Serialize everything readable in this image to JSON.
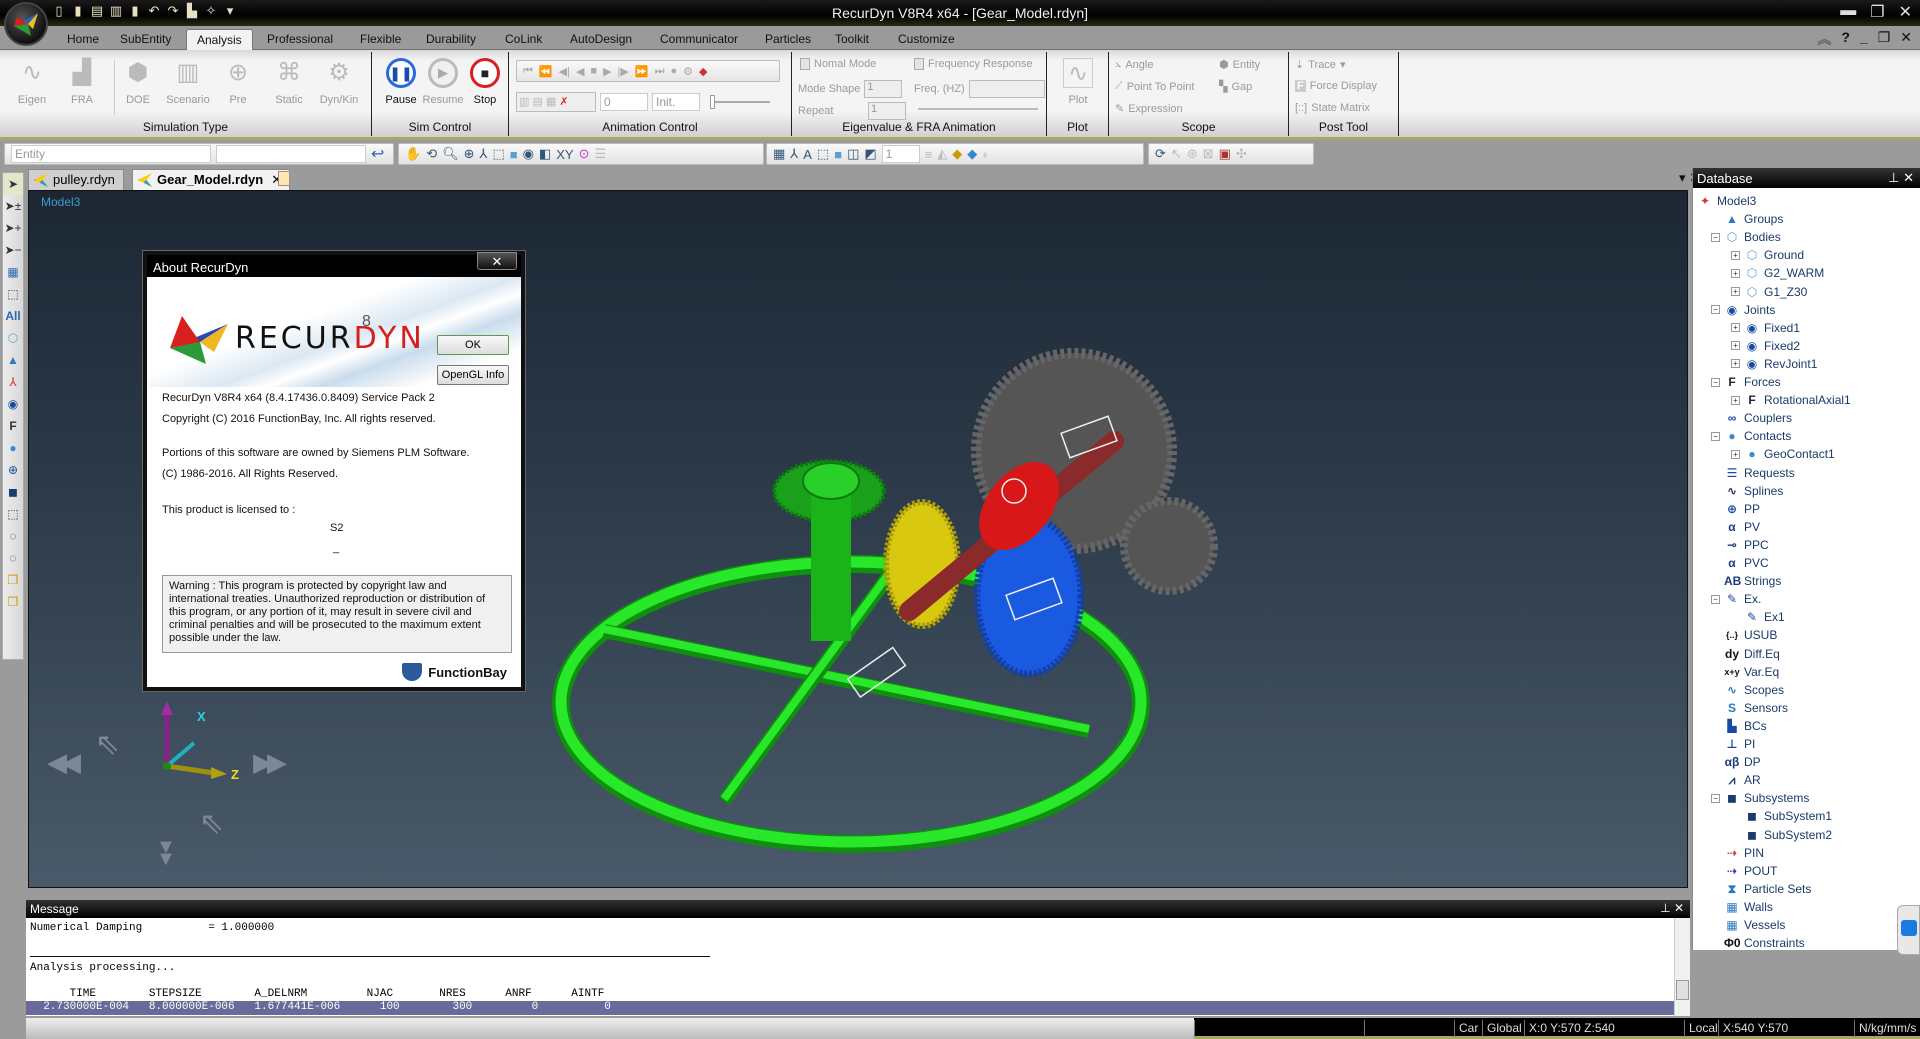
{
  "window": {
    "title": "RecurDyn V8R4 x64 - [Gear_Model.rdyn]"
  },
  "quick_access": [
    "new-icon",
    "open-icon",
    "save-icon",
    "save-as-icon",
    "import-icon",
    "undo-icon",
    "redo-icon",
    "export-icon",
    "settings-icon"
  ],
  "ribbon_tabs": [
    "Home",
    "SubEntity",
    "Analysis",
    "Professional",
    "Flexible",
    "Durability",
    "CoLink",
    "AutoDesign",
    "Communicator",
    "Particles",
    "Toolkit",
    "Customize"
  ],
  "active_tab": "Analysis",
  "ribbon": {
    "simulation_type": {
      "label": "Simulation Type",
      "buttons": [
        "Eigen",
        "FRA",
        "DOE",
        "Scenario",
        "Pre",
        "Static",
        "Dyn/Kin"
      ]
    },
    "sim_control": {
      "label": "Sim Control",
      "pause": "Pause",
      "resume": "Resume",
      "stop": "Stop"
    },
    "animation_control": {
      "label": "Animation Control",
      "frame_value": "0",
      "frame_mode": "Init."
    },
    "eigen_fra": {
      "label": "Eigenvalue & FRA Animation",
      "normal_mode": "Nomal Mode",
      "mode_shape": "Mode Shape",
      "mode_shape_value": "1",
      "repeat": "Repeat",
      "repeat_value": "1",
      "frequency_response": "Frequency Response",
      "freq": "Freq. (HZ)"
    },
    "plot": {
      "label": "Plot",
      "button": "Plot"
    },
    "scope": {
      "label": "Scope",
      "items": [
        "Angle",
        "Entity",
        "Point To Point",
        "Gap",
        "Expression"
      ]
    },
    "post_tool": {
      "label": "Post Tool",
      "items": [
        "Trace",
        "Force Display",
        "State Matrix"
      ]
    }
  },
  "toolbar": {
    "entity_combo": "Entity",
    "page_value": "1"
  },
  "doc_tabs": [
    {
      "label": "pulley.rdyn"
    },
    {
      "label": "Gear_Model.rdyn"
    }
  ],
  "viewport": {
    "model_label": "Model3",
    "axis_labels": {
      "x": "X",
      "z": "Z"
    }
  },
  "about_dialog": {
    "title": "About RecurDyn",
    "logo_prefix": "RECUR",
    "logo_suffix": "DYN",
    "logo_version": "8",
    "ok": "OK",
    "opengl": "OpenGL Info",
    "version_line": "RecurDyn V8R4 x64 (8.4.17436.0.8409) Service Pack 2",
    "copyright": "Copyright (C) 2016 FunctionBay, Inc. All rights reserved.",
    "portions": "Portions of this software are owned by Siemens PLM Software.",
    "portions_copyright": "(C) 1986-2016. All Rights Reserved.",
    "licensed_to_label": "This product is licensed to :",
    "licensee": "S2",
    "licensee_2": "_",
    "warning": "Warning : This program is protected by copyright law and international treaties. Unauthorized reproduction or distribution of this program, or any portion of it, may result in severe civil and criminal penalties and will be prosecuted to the maximum extent possible under the law.",
    "company": "FunctionBay"
  },
  "database": {
    "title": "Database",
    "items": [
      {
        "label": "Model3",
        "level": 0,
        "icon": "model-icon",
        "glyph": "✦",
        "color": "#d33"
      },
      {
        "label": "Groups",
        "level": 1,
        "icon": "groups-icon",
        "glyph": "▲",
        "color": "#2a7ac0"
      },
      {
        "label": "Bodies",
        "level": 1,
        "icon": "body-icon",
        "glyph": "⬡",
        "color": "#5aa0d0",
        "toggle": "−"
      },
      {
        "label": "Ground",
        "level": 2,
        "icon": "body-icon",
        "glyph": "⬡",
        "color": "#5aa0d0",
        "toggle": "+"
      },
      {
        "label": "G2_WARM",
        "level": 2,
        "icon": "body-icon",
        "glyph": "⬡",
        "color": "#5aa0d0",
        "toggle": "+"
      },
      {
        "label": "G1_Z30",
        "level": 2,
        "icon": "body-icon",
        "glyph": "⬡",
        "color": "#5aa0d0",
        "toggle": "+"
      },
      {
        "label": "Joints",
        "level": 1,
        "icon": "joint-icon",
        "glyph": "◉",
        "color": "#1a4aa0",
        "toggle": "−"
      },
      {
        "label": "Fixed1",
        "level": 2,
        "icon": "joint-icon",
        "glyph": "◉",
        "color": "#1a4aa0",
        "toggle": "+"
      },
      {
        "label": "Fixed2",
        "level": 2,
        "icon": "joint-icon",
        "glyph": "◉",
        "color": "#1a4aa0",
        "toggle": "+"
      },
      {
        "label": "RevJoint1",
        "level": 2,
        "icon": "joint-icon",
        "glyph": "◉",
        "color": "#1a4aa0",
        "toggle": "+"
      },
      {
        "label": "Forces",
        "level": 1,
        "icon": "force-icon",
        "glyph": "F",
        "color": "#223",
        "toggle": "−"
      },
      {
        "label": "RotationalAxial1",
        "level": 2,
        "icon": "force-icon",
        "glyph": "F",
        "color": "#223",
        "toggle": "+"
      },
      {
        "label": "Couplers",
        "level": 1,
        "icon": "coupler-icon",
        "glyph": "∞",
        "color": "#1a4aa0"
      },
      {
        "label": "Contacts",
        "level": 1,
        "icon": "contact-icon",
        "glyph": "●",
        "color": "#3a8ad0",
        "toggle": "−"
      },
      {
        "label": "GeoContact1",
        "level": 2,
        "icon": "contact-icon",
        "glyph": "●",
        "color": "#3a8ad0",
        "toggle": "+"
      },
      {
        "label": "Requests",
        "level": 1,
        "icon": "request-icon",
        "glyph": "☰",
        "color": "#1a4aa0"
      },
      {
        "label": "Splines",
        "level": 1,
        "icon": "spline-icon",
        "glyph": "∿",
        "color": "#1a2a50"
      },
      {
        "label": "PP",
        "level": 1,
        "icon": "pp-icon",
        "glyph": "⊕",
        "color": "#1a4aa0"
      },
      {
        "label": "PV",
        "level": 1,
        "icon": "pv-icon",
        "glyph": "α",
        "color": "#1a3a80"
      },
      {
        "label": "PPC",
        "level": 1,
        "icon": "ppc-icon",
        "glyph": "⊸",
        "color": "#1a3a80"
      },
      {
        "label": "PVC",
        "level": 1,
        "icon": "pvc-icon",
        "glyph": "α",
        "color": "#1a3a80"
      },
      {
        "label": "Strings",
        "level": 1,
        "icon": "strings-icon",
        "glyph": "AB",
        "color": "#1a3a80"
      },
      {
        "label": "Ex.",
        "level": 1,
        "icon": "pencil-icon",
        "glyph": "✎",
        "color": "#1a4aa0",
        "toggle": "−"
      },
      {
        "label": "Ex1",
        "level": 2,
        "icon": "pencil-icon",
        "glyph": "✎",
        "color": "#1a4aa0"
      },
      {
        "label": "USUB",
        "level": 1,
        "icon": "usub-icon",
        "glyph": "{..}",
        "color": "#111"
      },
      {
        "label": "Diff.Eq",
        "level": 1,
        "icon": "diffeq-icon",
        "glyph": "dy",
        "color": "#111"
      },
      {
        "label": "Var.Eq",
        "level": 1,
        "icon": "vareq-icon",
        "glyph": "x+y",
        "color": "#111"
      },
      {
        "label": "Scopes",
        "level": 1,
        "icon": "scope-icon",
        "glyph": "∿",
        "color": "#2a7ac0"
      },
      {
        "label": "Sensors",
        "level": 1,
        "icon": "sensor-icon",
        "glyph": "S",
        "color": "#2a7ac0"
      },
      {
        "label": "BCs",
        "level": 1,
        "icon": "bc-icon",
        "glyph": "▙",
        "color": "#1a4aa0"
      },
      {
        "label": "PI",
        "level": 1,
        "icon": "pi-icon",
        "glyph": "⊥",
        "color": "#1a4aa0"
      },
      {
        "label": "DP",
        "level": 1,
        "icon": "dp-icon",
        "glyph": "αβ",
        "color": "#1a3a80"
      },
      {
        "label": "AR",
        "level": 1,
        "icon": "ar-icon",
        "glyph": "⩘",
        "color": "#1a3a80"
      },
      {
        "label": "Subsystems",
        "level": 1,
        "icon": "subsystem-icon",
        "glyph": "◼",
        "color": "#1a3a70",
        "toggle": "−"
      },
      {
        "label": "SubSystem1",
        "level": 2,
        "icon": "subsystem-icon",
        "glyph": "◼",
        "color": "#1a3a70"
      },
      {
        "label": "SubSystem2",
        "level": 2,
        "icon": "subsystem-icon",
        "glyph": "◼",
        "color": "#1a3a70"
      },
      {
        "label": "PIN",
        "level": 1,
        "icon": "pin-icon",
        "glyph": "⇢",
        "color": "#c33"
      },
      {
        "label": "POUT",
        "level": 1,
        "icon": "pout-icon",
        "glyph": "⇢",
        "color": "#33c"
      },
      {
        "label": "Particle Sets",
        "level": 1,
        "icon": "particles-icon",
        "glyph": "⧗",
        "color": "#2a7ac0"
      },
      {
        "label": "Walls",
        "level": 1,
        "icon": "wall-icon",
        "glyph": "▦",
        "color": "#2a7ac0"
      },
      {
        "label": "Vessels",
        "level": 1,
        "icon": "vessel-icon",
        "glyph": "▦",
        "color": "#2a7ac0"
      },
      {
        "label": "Constraints",
        "level": 1,
        "icon": "constraint-icon",
        "glyph": "Φ0",
        "color": "#111"
      }
    ]
  },
  "message": {
    "title": "Message",
    "damping_line": "Numerical Damping          = 1.000000",
    "processing": "Analysis processing...",
    "header": "      TIME        STEPSIZE        A_DELNRM         NJAC       NRES      ANRF      AINTF",
    "row": "  2.730000E-004   8.000000E-006   1.677441E-006      100        300         0          0"
  },
  "status": {
    "coord_sys": "Car",
    "frame": "Global",
    "global_pos": "X:0 Y:570 Z:540",
    "local": "Local",
    "local_pos": "X:540 Y:570",
    "units": "N/kg/mm/s"
  }
}
